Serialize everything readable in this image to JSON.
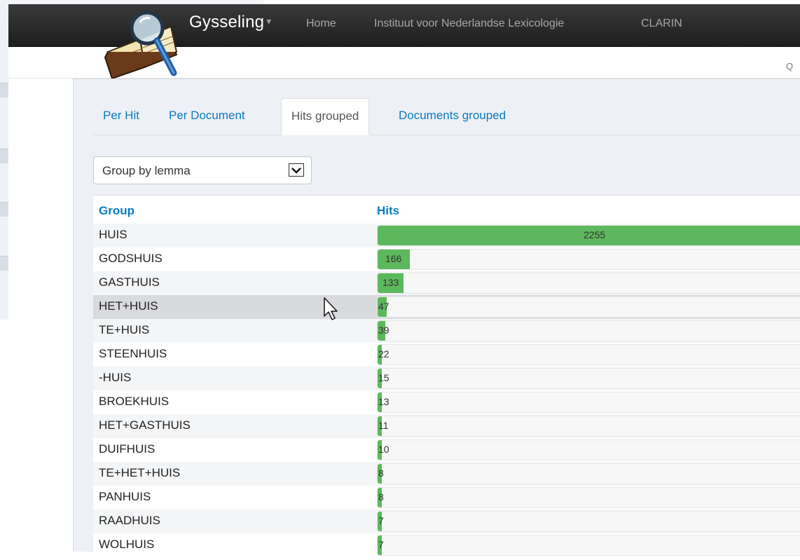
{
  "navbar": {
    "brand": "Gysseling",
    "links": [
      "Home",
      "Instituut voor Nederlandse Lexicologie",
      "CLARIN"
    ]
  },
  "subheader": {
    "label": "Q"
  },
  "tabs": [
    {
      "label": "Per Hit",
      "active": false
    },
    {
      "label": "Per Document",
      "active": false
    },
    {
      "label": "Hits grouped",
      "active": true
    },
    {
      "label": "Documents grouped",
      "active": false
    }
  ],
  "group_select": {
    "selected": "Group by lemma"
  },
  "table": {
    "headers": {
      "group": "Group",
      "hits": "Hits"
    },
    "max_hits": 2255,
    "rows": [
      {
        "lemma": "HUIS",
        "hits": "2255",
        "value": 2255
      },
      {
        "lemma": "GODSHUIS",
        "hits": "166",
        "value": 166
      },
      {
        "lemma": "GASTHUIS",
        "hits": "133",
        "value": 133
      },
      {
        "lemma": "HET+HUIS",
        "hits": "47",
        "value": 47
      },
      {
        "lemma": "TE+HUIS",
        "hits": "39",
        "value": 39
      },
      {
        "lemma": "STEENHUIS",
        "hits": "22",
        "value": 22
      },
      {
        "lemma": "-HUIS",
        "hits": "15",
        "value": 15
      },
      {
        "lemma": "BROEKHUIS",
        "hits": "13",
        "value": 13
      },
      {
        "lemma": "HET+GASTHUIS",
        "hits": "11",
        "value": 11
      },
      {
        "lemma": "DUIFHUIS",
        "hits": "10",
        "value": 10
      },
      {
        "lemma": "TE+HET+HUIS",
        "hits": "8",
        "value": 8
      },
      {
        "lemma": "PANHUIS",
        "hits": "8",
        "value": 8
      },
      {
        "lemma": "RAADHUIS",
        "hits": "7",
        "value": 7
      },
      {
        "lemma": "WOLHUIS",
        "hits": "7",
        "value": 7
      }
    ]
  },
  "colors": {
    "bar": "#5cb85c",
    "link": "#0a7bbf",
    "navbar": "#2a2a2a"
  },
  "icons": {
    "logo": "book-magnifier-logo",
    "select": "chevron-down-icon",
    "cursor": "mouse-pointer-icon"
  }
}
